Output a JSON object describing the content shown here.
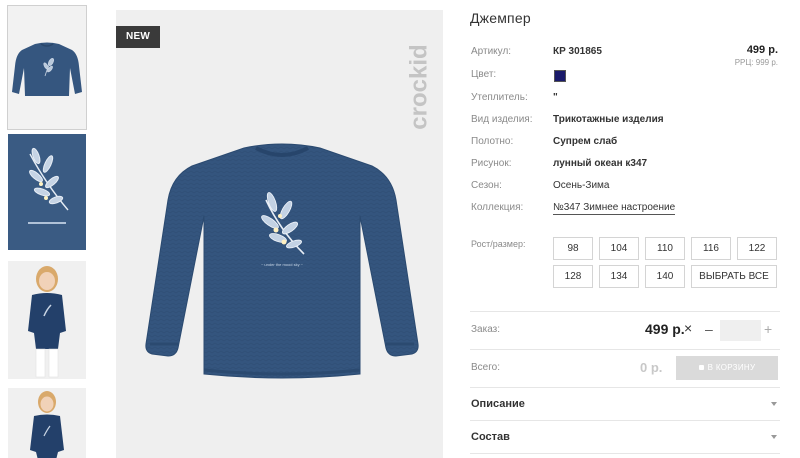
{
  "product": {
    "badge": "NEW",
    "brand": "crockid",
    "title": "Джемпер",
    "price": "499 р.",
    "rrp": "РРЦ: 999 р.",
    "swatch_color": "#1a1a6a",
    "sweater_color": "#34557e",
    "print_text": "~ under the mood sky ~"
  },
  "attributes": [
    {
      "label": "Артикул:",
      "value": "КР 301865"
    },
    {
      "label": "Цвет:",
      "value": ""
    },
    {
      "label": "Утеплитель:",
      "value": "\""
    },
    {
      "label": "Вид изделия:",
      "value": "Трикотажные изделия"
    },
    {
      "label": "Полотно:",
      "value": "Супрем слаб"
    },
    {
      "label": "Рисунок:",
      "value": "лунный океан к347"
    },
    {
      "label": "Сезон:",
      "value": "Осень-Зима"
    },
    {
      "label": "Коллекция:",
      "value": "№347 Зимнее настроение"
    }
  ],
  "sizes": {
    "label": "Рост/размер:",
    "options": [
      "98",
      "104",
      "110",
      "116",
      "122",
      "128",
      "134",
      "140"
    ],
    "select_all": "ВЫБРАТЬ ВСЕ"
  },
  "order": {
    "label": "Заказ:",
    "price": "499 р.",
    "multiply": "×",
    "minus": "–",
    "plus": "+",
    "quantity": ""
  },
  "total": {
    "label": "Всего:",
    "value": "0 р.",
    "cart_button": "В КОРЗИНУ"
  },
  "accordion": [
    {
      "title": "Описание"
    },
    {
      "title": "Состав"
    }
  ]
}
